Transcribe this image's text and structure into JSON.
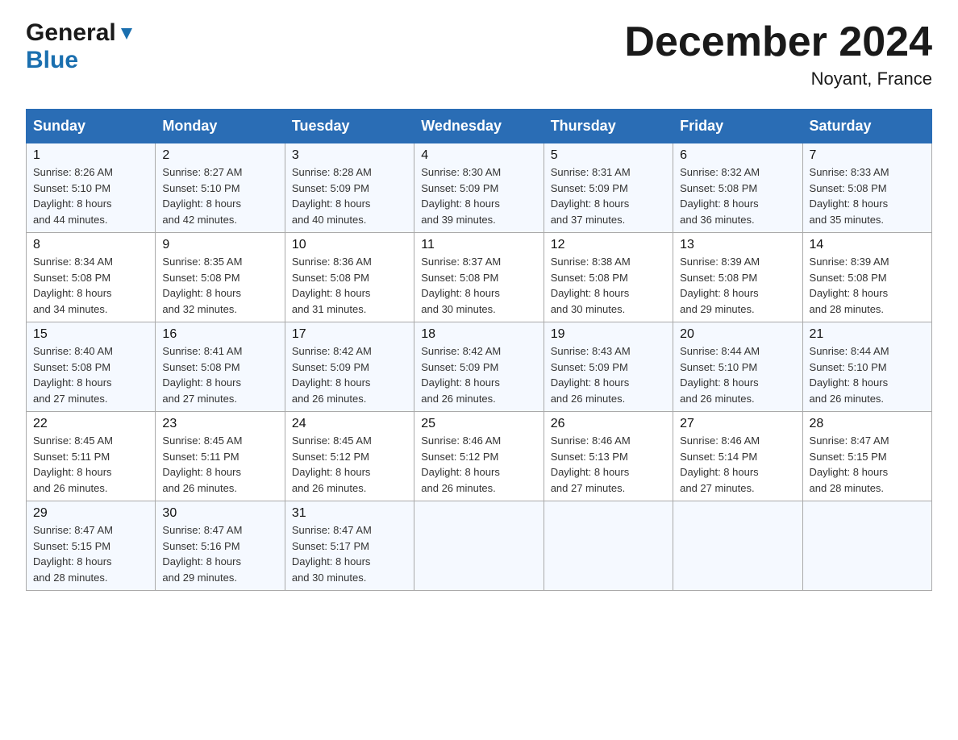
{
  "header": {
    "logo_general": "General",
    "logo_blue": "Blue",
    "month_title": "December 2024",
    "location": "Noyant, France"
  },
  "days_of_week": [
    "Sunday",
    "Monday",
    "Tuesday",
    "Wednesday",
    "Thursday",
    "Friday",
    "Saturday"
  ],
  "weeks": [
    [
      {
        "day": "1",
        "sunrise": "8:26 AM",
        "sunset": "5:10 PM",
        "daylight": "8 hours and 44 minutes."
      },
      {
        "day": "2",
        "sunrise": "8:27 AM",
        "sunset": "5:10 PM",
        "daylight": "8 hours and 42 minutes."
      },
      {
        "day": "3",
        "sunrise": "8:28 AM",
        "sunset": "5:09 PM",
        "daylight": "8 hours and 40 minutes."
      },
      {
        "day": "4",
        "sunrise": "8:30 AM",
        "sunset": "5:09 PM",
        "daylight": "8 hours and 39 minutes."
      },
      {
        "day": "5",
        "sunrise": "8:31 AM",
        "sunset": "5:09 PM",
        "daylight": "8 hours and 37 minutes."
      },
      {
        "day": "6",
        "sunrise": "8:32 AM",
        "sunset": "5:08 PM",
        "daylight": "8 hours and 36 minutes."
      },
      {
        "day": "7",
        "sunrise": "8:33 AM",
        "sunset": "5:08 PM",
        "daylight": "8 hours and 35 minutes."
      }
    ],
    [
      {
        "day": "8",
        "sunrise": "8:34 AM",
        "sunset": "5:08 PM",
        "daylight": "8 hours and 34 minutes."
      },
      {
        "day": "9",
        "sunrise": "8:35 AM",
        "sunset": "5:08 PM",
        "daylight": "8 hours and 32 minutes."
      },
      {
        "day": "10",
        "sunrise": "8:36 AM",
        "sunset": "5:08 PM",
        "daylight": "8 hours and 31 minutes."
      },
      {
        "day": "11",
        "sunrise": "8:37 AM",
        "sunset": "5:08 PM",
        "daylight": "8 hours and 30 minutes."
      },
      {
        "day": "12",
        "sunrise": "8:38 AM",
        "sunset": "5:08 PM",
        "daylight": "8 hours and 30 minutes."
      },
      {
        "day": "13",
        "sunrise": "8:39 AM",
        "sunset": "5:08 PM",
        "daylight": "8 hours and 29 minutes."
      },
      {
        "day": "14",
        "sunrise": "8:39 AM",
        "sunset": "5:08 PM",
        "daylight": "8 hours and 28 minutes."
      }
    ],
    [
      {
        "day": "15",
        "sunrise": "8:40 AM",
        "sunset": "5:08 PM",
        "daylight": "8 hours and 27 minutes."
      },
      {
        "day": "16",
        "sunrise": "8:41 AM",
        "sunset": "5:08 PM",
        "daylight": "8 hours and 27 minutes."
      },
      {
        "day": "17",
        "sunrise": "8:42 AM",
        "sunset": "5:09 PM",
        "daylight": "8 hours and 26 minutes."
      },
      {
        "day": "18",
        "sunrise": "8:42 AM",
        "sunset": "5:09 PM",
        "daylight": "8 hours and 26 minutes."
      },
      {
        "day": "19",
        "sunrise": "8:43 AM",
        "sunset": "5:09 PM",
        "daylight": "8 hours and 26 minutes."
      },
      {
        "day": "20",
        "sunrise": "8:44 AM",
        "sunset": "5:10 PM",
        "daylight": "8 hours and 26 minutes."
      },
      {
        "day": "21",
        "sunrise": "8:44 AM",
        "sunset": "5:10 PM",
        "daylight": "8 hours and 26 minutes."
      }
    ],
    [
      {
        "day": "22",
        "sunrise": "8:45 AM",
        "sunset": "5:11 PM",
        "daylight": "8 hours and 26 minutes."
      },
      {
        "day": "23",
        "sunrise": "8:45 AM",
        "sunset": "5:11 PM",
        "daylight": "8 hours and 26 minutes."
      },
      {
        "day": "24",
        "sunrise": "8:45 AM",
        "sunset": "5:12 PM",
        "daylight": "8 hours and 26 minutes."
      },
      {
        "day": "25",
        "sunrise": "8:46 AM",
        "sunset": "5:12 PM",
        "daylight": "8 hours and 26 minutes."
      },
      {
        "day": "26",
        "sunrise": "8:46 AM",
        "sunset": "5:13 PM",
        "daylight": "8 hours and 27 minutes."
      },
      {
        "day": "27",
        "sunrise": "8:46 AM",
        "sunset": "5:14 PM",
        "daylight": "8 hours and 27 minutes."
      },
      {
        "day": "28",
        "sunrise": "8:47 AM",
        "sunset": "5:15 PM",
        "daylight": "8 hours and 28 minutes."
      }
    ],
    [
      {
        "day": "29",
        "sunrise": "8:47 AM",
        "sunset": "5:15 PM",
        "daylight": "8 hours and 28 minutes."
      },
      {
        "day": "30",
        "sunrise": "8:47 AM",
        "sunset": "5:16 PM",
        "daylight": "8 hours and 29 minutes."
      },
      {
        "day": "31",
        "sunrise": "8:47 AM",
        "sunset": "5:17 PM",
        "daylight": "8 hours and 30 minutes."
      },
      null,
      null,
      null,
      null
    ]
  ],
  "labels": {
    "sunrise": "Sunrise:",
    "sunset": "Sunset:",
    "daylight": "Daylight:"
  },
  "accent_color": "#2a6db5"
}
